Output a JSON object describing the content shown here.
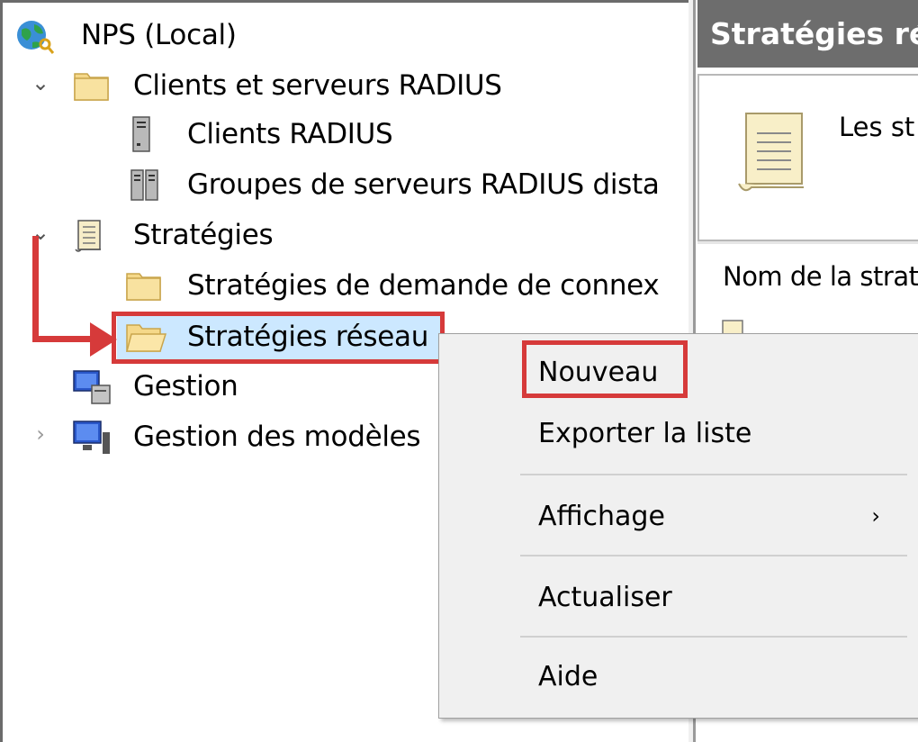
{
  "tree": {
    "root": "NPS (Local)",
    "items": [
      {
        "label": "Clients et serveurs RADIUS",
        "expander": "⌄"
      },
      {
        "label": "Clients RADIUS"
      },
      {
        "label": "Groupes de serveurs RADIUS dista"
      },
      {
        "label": "Stratégies",
        "expander": "⌄"
      },
      {
        "label": "Stratégies de demande de connex"
      },
      {
        "label": "Stratégies réseau"
      },
      {
        "label": "Gestion"
      },
      {
        "label": "Gestion des modèles",
        "expander": "›"
      }
    ]
  },
  "right_pane": {
    "header": "Stratégies ré",
    "description": "Les st",
    "column_header": "Nom de la strat"
  },
  "context_menu": {
    "items": [
      {
        "label": "Nouveau"
      },
      {
        "label": "Exporter la liste"
      },
      {
        "label": "Affichage",
        "submenu_arrow": "›"
      },
      {
        "label": "Actualiser"
      },
      {
        "label": "Aide"
      }
    ]
  },
  "colors": {
    "highlight": "#d63a3a",
    "menu_bg": "#f0f0f0",
    "header_bg": "#6d6d6d",
    "selection_bg": "#cce8ff"
  }
}
